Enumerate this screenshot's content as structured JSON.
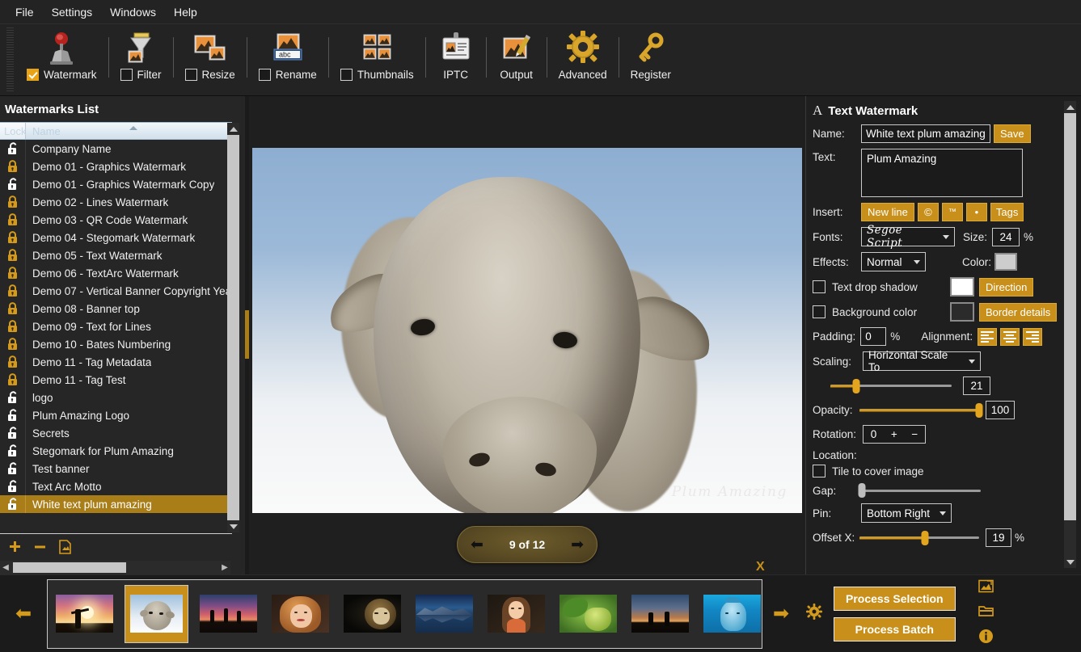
{
  "menubar": {
    "items": [
      {
        "label": "File"
      },
      {
        "label": "Settings"
      },
      {
        "label": "Windows"
      },
      {
        "label": "Help"
      }
    ]
  },
  "toolbar": {
    "items": [
      {
        "label": "Watermark",
        "icon": "watermark-stamp-icon",
        "checkbox": true,
        "checked": true
      },
      {
        "label": "Filter",
        "icon": "filter-funnel-icon",
        "checkbox": true,
        "checked": false
      },
      {
        "label": "Resize",
        "icon": "resize-images-icon",
        "checkbox": true,
        "checked": false
      },
      {
        "label": "Rename",
        "icon": "rename-abc-icon",
        "checkbox": true,
        "checked": false
      },
      {
        "label": "Thumbnails",
        "icon": "thumbnails-grid-icon",
        "checkbox": true,
        "checked": false
      },
      {
        "label": "IPTC",
        "icon": "iptc-card-icon",
        "checkbox": false,
        "checked": false
      },
      {
        "label": "Output",
        "icon": "output-pencil-image-icon",
        "checkbox": false,
        "checked": false
      },
      {
        "label": "Advanced",
        "icon": "gear-icon",
        "checkbox": false,
        "checked": false
      },
      {
        "label": "Register",
        "icon": "key-icon",
        "checkbox": false,
        "checked": false
      }
    ]
  },
  "left_panel": {
    "title": "Watermarks List",
    "columns": [
      "Lock",
      "Name"
    ],
    "rows": [
      {
        "name": "Company Name",
        "locked": false
      },
      {
        "name": "Demo 01 - Graphics Watermark",
        "locked": true
      },
      {
        "name": "Demo 01 - Graphics Watermark Copy",
        "locked": false
      },
      {
        "name": "Demo 02 - Lines Watermark",
        "locked": true
      },
      {
        "name": "Demo 03 - QR Code Watermark",
        "locked": true
      },
      {
        "name": "Demo 04 - Stegomark Watermark",
        "locked": true
      },
      {
        "name": "Demo 05 - Text Watermark",
        "locked": true
      },
      {
        "name": "Demo 06 - TextArc Watermark",
        "locked": true
      },
      {
        "name": "Demo 07 - Vertical Banner Copyright Yea",
        "locked": true
      },
      {
        "name": "Demo 08 - Banner top",
        "locked": true
      },
      {
        "name": "Demo 09 - Text for Lines",
        "locked": true
      },
      {
        "name": "Demo 10 - Bates Numbering",
        "locked": true
      },
      {
        "name": "Demo 11 - Tag Metadata",
        "locked": true
      },
      {
        "name": "Demo 11 - Tag Test",
        "locked": true
      },
      {
        "name": "logo",
        "locked": false
      },
      {
        "name": "Plum Amazing Logo",
        "locked": false
      },
      {
        "name": "Secrets",
        "locked": false
      },
      {
        "name": "Stegomark for Plum Amazing",
        "locked": false
      },
      {
        "name": "Test banner",
        "locked": false
      },
      {
        "name": "Text Arc Motto",
        "locked": false
      },
      {
        "name": "White text plum amazing",
        "locked": false,
        "selected": true
      }
    ],
    "tools": [
      {
        "icon": "add-plus-icon",
        "label": "+"
      },
      {
        "icon": "remove-minus-icon",
        "label": "—"
      },
      {
        "icon": "duplicate-file-icon",
        "label": ""
      }
    ]
  },
  "preview": {
    "watermark_text": "Plum Amazing",
    "nav": {
      "prev": "←",
      "next": "→",
      "counter": "9 of 12"
    }
  },
  "right_panel": {
    "title": "Text Watermark",
    "name_label": "Name:",
    "name_value": "White text plum amazing",
    "save_label": "Save",
    "text_label": "Text:",
    "text_value": "Plum Amazing",
    "insert_label": "Insert:",
    "insert_buttons": [
      {
        "label": "New line"
      },
      {
        "label": "©"
      },
      {
        "label": "™"
      },
      {
        "label": "•"
      },
      {
        "label": "Tags"
      }
    ],
    "fonts_label": "Fonts:",
    "font_value": "Segoe Script",
    "size_label": "Size:",
    "size_value": "24",
    "size_unit": "%",
    "effects_label": "Effects:",
    "effects_value": "Normal",
    "color_label": "Color:",
    "color_swatch": "#cdcdcd",
    "drop_shadow_label": "Text drop shadow",
    "drop_shadow_checked": false,
    "drop_shadow_swatch": "#ffffff",
    "direction_label": "Direction",
    "background_label": "Background color",
    "background_checked": false,
    "background_swatch": "#2b2b2b",
    "border_details_label": "Border details",
    "padding_label": "Padding:",
    "padding_value": "0",
    "padding_unit": "%",
    "alignment_label": "Alignment:",
    "alignment_options": [
      "align-left",
      "align-center",
      "align-right"
    ],
    "scaling_label": "Scaling:",
    "scaling_value": "Horizontal Scale To",
    "scale_value": "21",
    "opacity_label": "Opacity:",
    "opacity_value": "100",
    "rotation_label": "Rotation:",
    "rotation_value": "0",
    "location_label": "Location:",
    "tile_label": "Tile to cover image",
    "tile_checked": false,
    "gap_label": "Gap:",
    "gap_value": 0,
    "pin_label": "Pin:",
    "pin_value": "Bottom Right",
    "offset_x_label": "Offset X:",
    "offset_x_value": "19",
    "offset_x_unit": "%"
  },
  "bottom": {
    "prev_icon": "←",
    "next_icon": "→",
    "close_mark": "X",
    "gear_icon": "gear-icon",
    "process_selection_label": "Process Selection",
    "process_batch_label": "Process Batch",
    "side_icons": [
      {
        "icon": "image-preview-icon"
      },
      {
        "icon": "open-folder-icon"
      },
      {
        "icon": "info-icon"
      }
    ],
    "thumbnails": [
      {
        "name": "sunset-silhouette",
        "selected": false
      },
      {
        "name": "sheep",
        "selected": true
      },
      {
        "name": "jumping-friends-sunset",
        "selected": false
      },
      {
        "name": "red-haired-woman",
        "selected": false
      },
      {
        "name": "lion",
        "selected": false
      },
      {
        "name": "mountain-lake",
        "selected": false
      },
      {
        "name": "smiling-woman",
        "selected": false
      },
      {
        "name": "green-grapes",
        "selected": false
      },
      {
        "name": "field-sunset",
        "selected": false
      },
      {
        "name": "dolphin",
        "selected": false
      }
    ]
  },
  "colors": {
    "accent": "#c8901a",
    "accent_light": "#e3a51d",
    "panel_bg": "#1f1f1f",
    "toolbar_bg": "#232323",
    "selection": "#a97d18"
  }
}
